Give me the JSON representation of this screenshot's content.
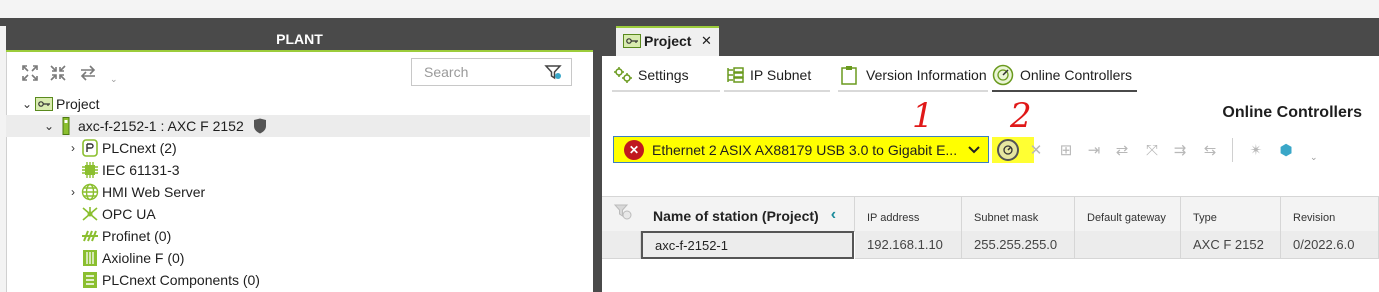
{
  "plant": {
    "title": "PLANT",
    "search": {
      "placeholder": "Search"
    },
    "tree": [
      {
        "label": "Project",
        "icon": "project-icon"
      },
      {
        "label": "axc-f-2152-1 : AXC F 2152",
        "icon": "controller-icon"
      },
      {
        "label": "PLCnext (2)",
        "icon": "plcnext-icon"
      },
      {
        "label": "IEC 61131-3",
        "icon": "chip-icon"
      },
      {
        "label": "HMI Web Server",
        "icon": "globe-icon"
      },
      {
        "label": "OPC UA",
        "icon": "opcua-icon"
      },
      {
        "label": "Profinet (0)",
        "icon": "profinet-icon"
      },
      {
        "label": "Axioline F (0)",
        "icon": "axioline-icon"
      },
      {
        "label": "PLCnext Components (0)",
        "icon": "components-icon"
      }
    ]
  },
  "editor": {
    "tab": {
      "label": "Project",
      "close": "✕"
    },
    "subtabs": [
      {
        "label": "Settings",
        "icon": "settings-icon"
      },
      {
        "label": "IP Subnet",
        "icon": "ip-subnet-icon"
      },
      {
        "label": "Version Information",
        "icon": "clipboard-icon"
      },
      {
        "label": "Online Controllers",
        "icon": "online-controllers-icon"
      }
    ],
    "section_title": "Online Controllers",
    "adapter": {
      "value": "Ethernet 2 ASIX AX88179 USB 3.0 to Gigabit E...",
      "status": "error"
    },
    "annotations": [
      "1",
      "2"
    ],
    "table": {
      "columns": [
        "Name of station (Project)",
        "IP address",
        "Subnet mask",
        "Default gateway",
        "Type",
        "Revision"
      ],
      "rows": [
        {
          "name": "axc-f-2152-1",
          "ip": "192.168.1.10",
          "subnet": "255.255.255.0",
          "gateway": "",
          "type": "AXC F 2152",
          "revision": "0/2022.6.0"
        }
      ]
    }
  },
  "colors": {
    "accent": "#9ccc3b",
    "dark": "#4a4a4a",
    "highlight": "#ffff00",
    "error": "#c0181e"
  }
}
